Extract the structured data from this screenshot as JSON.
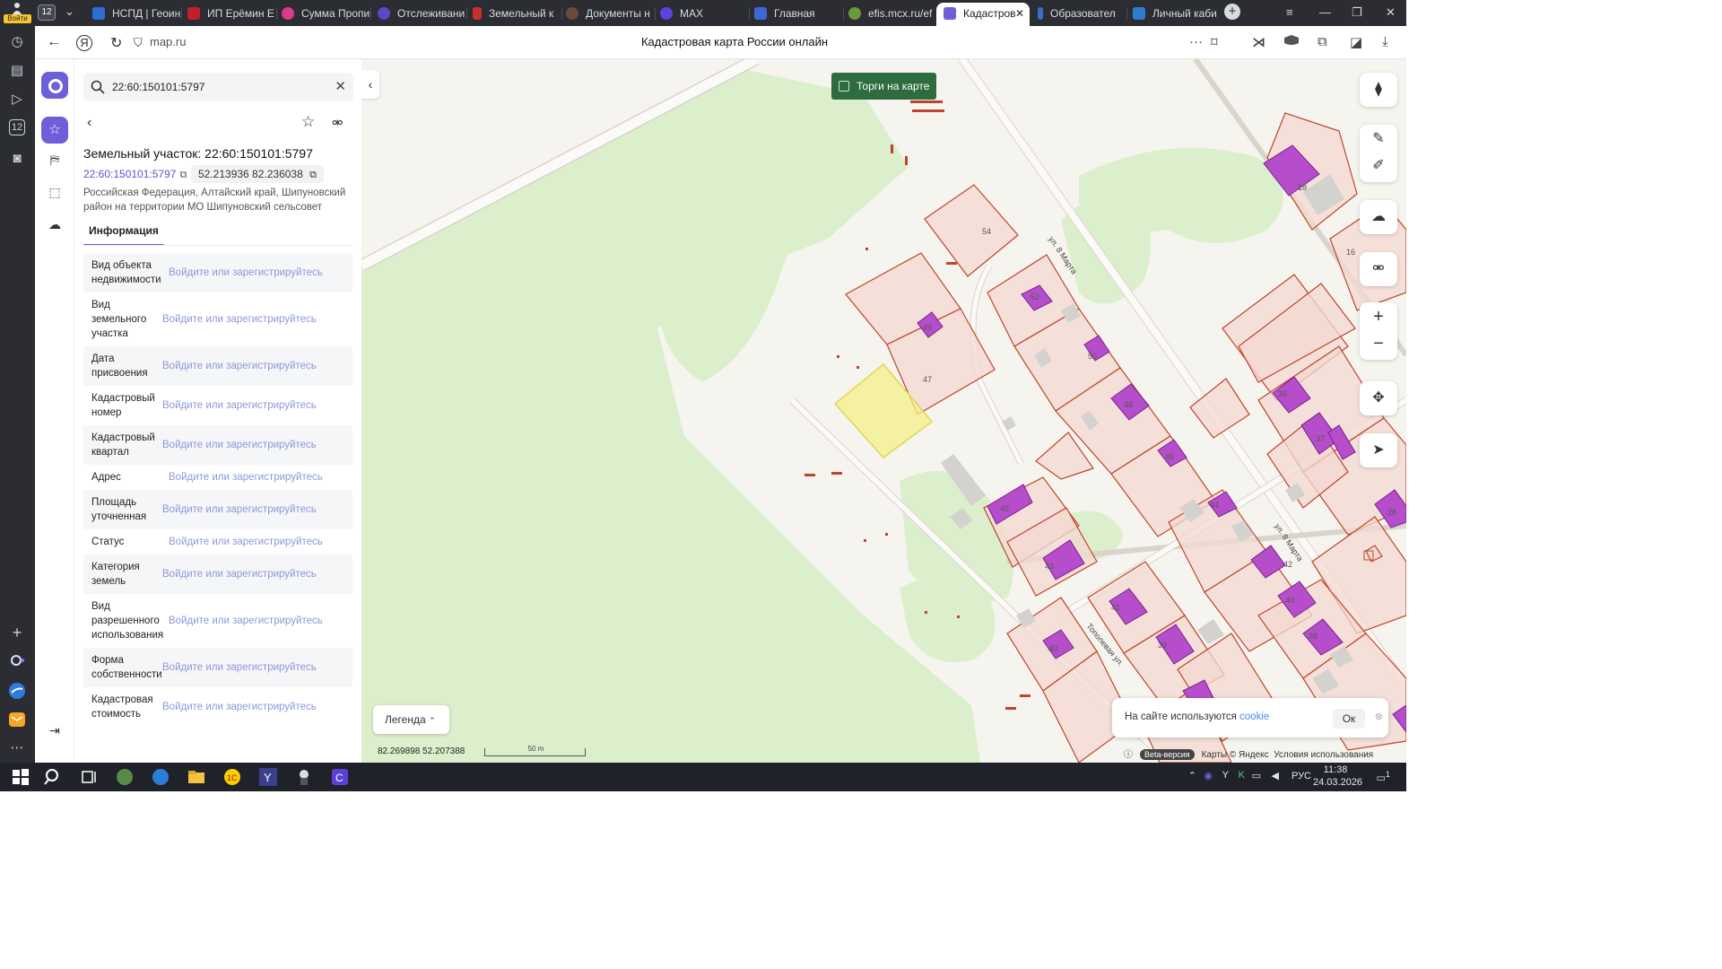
{
  "browser": {
    "login_label": "Войти",
    "tab_count": "12",
    "tabs": [
      {
        "label": "НСПД | Геоин"
      },
      {
        "label": "ИП Ерёмин Е"
      },
      {
        "label": "Сумма Пропи"
      },
      {
        "label": "Отслеживани"
      },
      {
        "label": "Земельный к"
      },
      {
        "label": "Документы н"
      },
      {
        "label": "MAX"
      },
      {
        "label": "Главная"
      },
      {
        "label": "efis.mcx.ru/ef"
      },
      {
        "label": "Кадастров"
      },
      {
        "label": "Образовател"
      },
      {
        "label": "Личный каби"
      }
    ],
    "url": "map.ru",
    "page_title": "Кадастровая карта России онлайн"
  },
  "colors": {
    "accent": "#6c5fd8",
    "parcel_border": "#c0442b",
    "parcel_fill": "#f3d9d2",
    "building_fill": "#b64ecb",
    "selected_parcel": "#f4f08a",
    "green_area": "#dcefcc",
    "torgi_button": "#2e6b3e"
  },
  "search": {
    "value": "22:60:150101:5797"
  },
  "parcel": {
    "title": "Земельный участок: 22:60:150101:5797",
    "cad_number": "22:60:150101:5797",
    "coords": "52.213936 82.236038",
    "address": "Российская Федерация, Алтайский край, Шипуновский район на территории МО Шипуновский сельсовет",
    "tab_label": "Информация",
    "login_prompt": "Войдите или зарегистрируйтесь",
    "fields": [
      {
        "label": "Вид объекта недвижимости"
      },
      {
        "label": "Вид земельного участка"
      },
      {
        "label": "Дата присвоения"
      },
      {
        "label": "Кадастровый номер"
      },
      {
        "label": "Кадастровый квартал"
      },
      {
        "label": "Адрес"
      },
      {
        "label": "Площадь уточненная"
      },
      {
        "label": "Статус"
      },
      {
        "label": "Категория земель"
      },
      {
        "label": "Вид разрешенного использования"
      },
      {
        "label": "Форма собственности"
      },
      {
        "label": "Кадастровая стоимость"
      }
    ]
  },
  "map": {
    "torgi_label": "Торги на карте",
    "legend_label": "Легенда",
    "cursor_coords": "82.269898  52.207388",
    "scale_label": "50 m",
    "streets": [
      "ул. 8 Марта",
      "ул. 8 Марта",
      "Тополевая ул."
    ],
    "house_numbers": [
      "54",
      "52",
      "49",
      "50",
      "47",
      "48",
      "45",
      "46",
      "44",
      "43",
      "42",
      "41",
      "40",
      "39",
      "40",
      "38",
      "39",
      "37",
      "28",
      "18",
      "16"
    ],
    "cookie_text": "На сайте используются",
    "cookie_link": "cookie",
    "cookie_ok": "Ок",
    "beta_label": "Beta-версия",
    "attribution": "Карты © Яндекс",
    "terms": "Условия использования"
  },
  "taskbar": {
    "lang": "РУС",
    "time": "11:38",
    "date": "24.03.2026",
    "notifications": "1"
  }
}
